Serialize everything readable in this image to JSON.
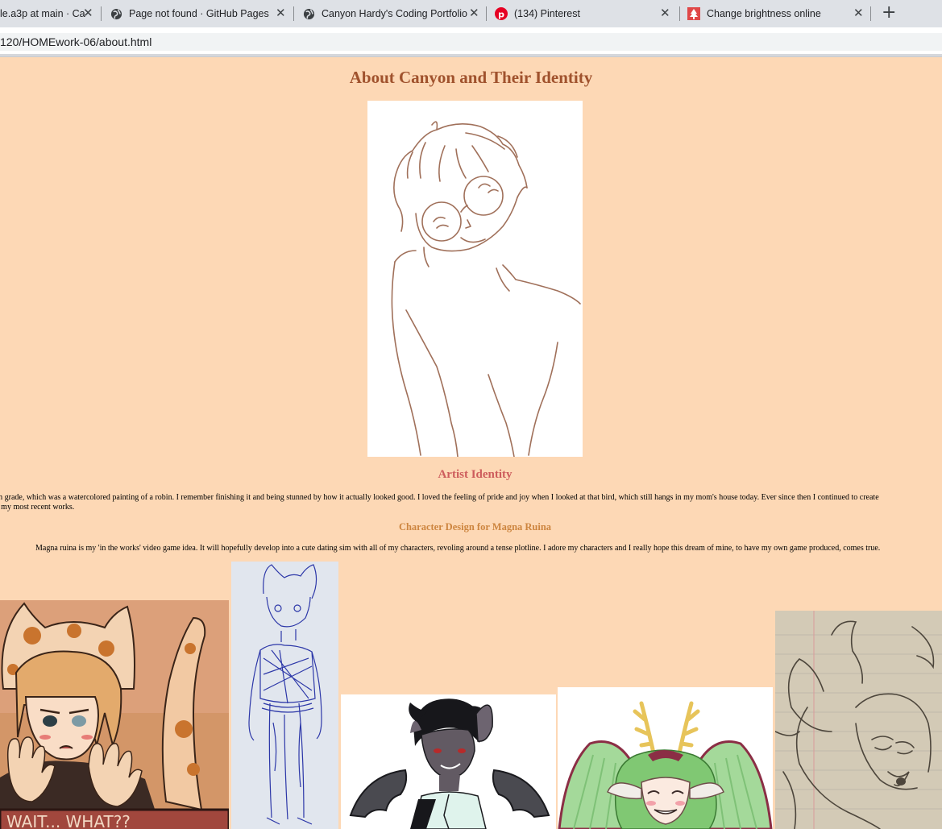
{
  "browser": {
    "tabs": [
      {
        "label": "le.a3p at main · Ca",
        "icon": "github-icon"
      },
      {
        "label": "Page not found · GitHub Pages",
        "icon": "globe-icon"
      },
      {
        "label": "Canyon Hardy's Coding Portfolio",
        "icon": "globe-icon"
      },
      {
        "label": "(134) Pinterest",
        "icon": "pinterest-icon"
      },
      {
        "label": "Change brightness online",
        "icon": "tree-icon"
      }
    ],
    "new_tab_symbol": "+",
    "close_symbol": "✕",
    "address": "120/HOMEwork-06/about.html"
  },
  "page": {
    "title": "About Canyon and Their Identity",
    "artist_heading": "Artist Identity",
    "artist_paragraph_line1": "rth grade, which was a watercolored painting of a robin. I remember finishing it and being stunned by how it actually looked good. I loved the feeling of pride and joy when I looked at that bird, which still hangs in my mom's house today. Ever since then I continued to create",
    "artist_paragraph_line2": "st my most recent works.",
    "magna_heading": "Character Design for Magna Ruina",
    "magna_paragraph": "Magna ruina is my 'in the works' video game idea. It will hopefully develop into a cute dating sim with all of my characters, revoling around a tense plotline. I adore my characters and I really hope this dream of mine, to have my own game produced, comes true.",
    "artwork_caption_text": "WAIT... WHAT??"
  },
  "colors": {
    "page_background": "#fdd8b5",
    "title_color": "#a0522d",
    "artist_heading_color": "#cd5c5c",
    "magna_heading_color": "#cd853f"
  }
}
